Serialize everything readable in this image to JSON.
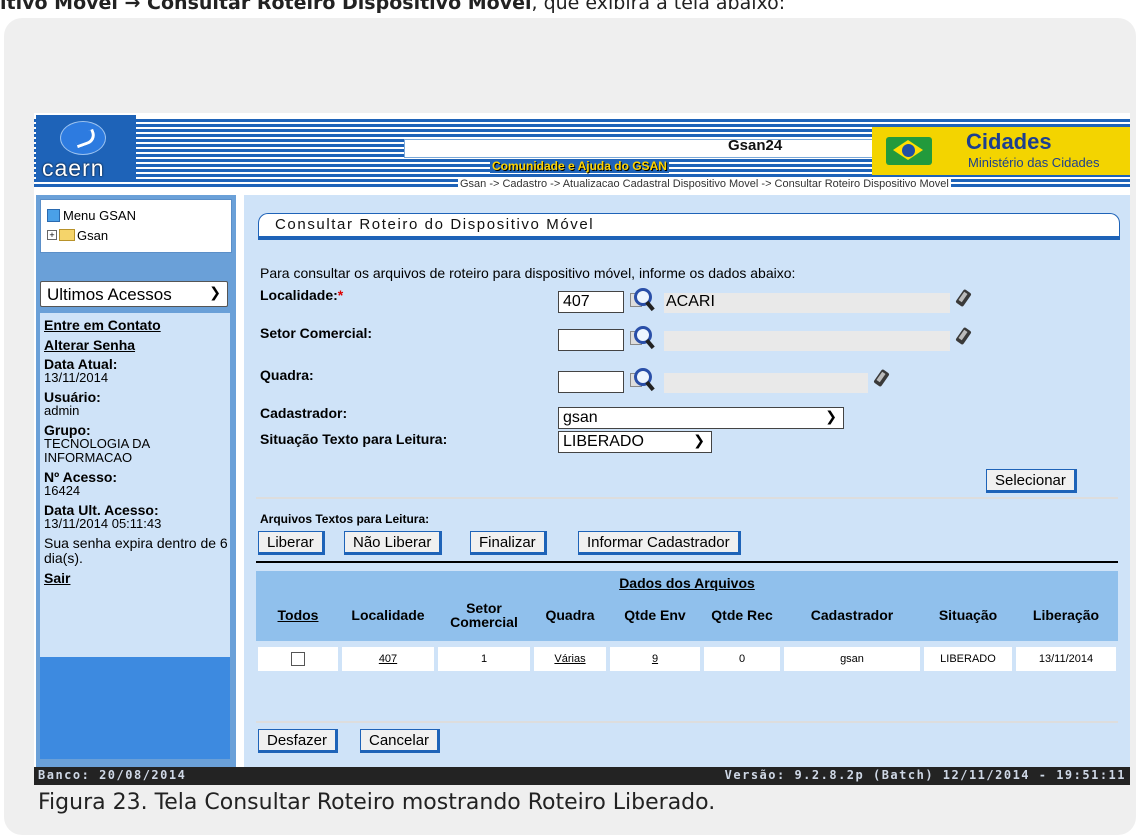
{
  "doc": {
    "top_text_bold": "itivo Móvel → Consultar Roteiro Dispositivo Móvel",
    "top_text_rest": ", que exibirá a tela abaixo:",
    "caption": "Figura 23. Tela Consultar Roteiro mostrando Roteiro Liberado."
  },
  "header": {
    "logo_text": "caern",
    "app_title": "Gsan24",
    "community_link": "Comunidade e Ajuda do GSAN",
    "breadcrumb": "Gsan -> Cadastro -> Atualizacao Cadastral Dispositivo Movel -> Consultar Roteiro Dispositivo Movel",
    "brand_title": "Cidades",
    "brand_subtitle": "Ministério das Cidades"
  },
  "sidebar": {
    "menu_title": "Menu GSAN",
    "tree_root": "Gsan",
    "recent_select": "Ultimos Acessos",
    "links": [
      "Entre em Contato",
      "Alterar Senha"
    ],
    "data_atual_label": "Data Atual:",
    "data_atual": "13/11/2014",
    "usuario_label": "Usuário:",
    "usuario": "admin",
    "grupo_label": "Grupo:",
    "grupo": "TECNOLOGIA DA INFORMACAO",
    "acesso_label": "Nº Acesso:",
    "acesso": "16424",
    "ult_acesso_label": "Data Ult. Acesso:",
    "ult_acesso": "13/11/2014 05:11:43",
    "senha_msg": "Sua senha expira dentro de 6 dia(s).",
    "sair": "Sair"
  },
  "form": {
    "title": "Consultar Roteiro do Dispositivo Móvel",
    "intro": "Para consultar os arquivos de roteiro para dispositivo móvel, informe os dados abaixo:",
    "localidade_label": "Localidade:",
    "localidade_required": "*",
    "localidade_value": "407",
    "localidade_desc": "ACARI",
    "setor_label": "Setor Comercial:",
    "setor_value": "",
    "setor_desc": "",
    "quadra_label": "Quadra:",
    "quadra_value": "",
    "quadra_desc": "",
    "cadastrador_label": "Cadastrador:",
    "cadastrador_value": "gsan",
    "situacao_label": "Situação Texto para Leitura:",
    "situacao_value": "LIBERADO",
    "selecionar": "Selecionar"
  },
  "arquivos": {
    "section_label": "Arquivos Textos para Leitura:",
    "buttons": [
      "Liberar",
      "Não Liberar",
      "Finalizar",
      "Informar Cadastrador"
    ]
  },
  "table": {
    "title": "Dados dos Arquivos",
    "headers": [
      "Todos",
      "Localidade",
      "Setor Comercial",
      "Quadra",
      "Qtde Env",
      "Qtde Rec",
      "Cadastrador",
      "Situação",
      "Liberação"
    ],
    "rows": [
      {
        "localidade": "407",
        "setor": "1",
        "quadra": "Várias",
        "qtde_env": "9",
        "qtde_rec": "0",
        "cadastrador": "gsan",
        "situacao": "LIBERADO",
        "liberacao": "13/11/2014"
      }
    ]
  },
  "actions": {
    "desfazer": "Desfazer",
    "cancelar": "Cancelar"
  },
  "footer": {
    "banco": "Banco: 20/08/2014",
    "versao": "Versão: 9.2.8.2p (Batch) 12/11/2014 - 19:51:11"
  },
  "colors": {
    "accent_blue": "#1e63b8",
    "panel_blue": "#cfe3f8",
    "table_header": "#90c0ec",
    "brand_yellow": "#f3d400"
  }
}
